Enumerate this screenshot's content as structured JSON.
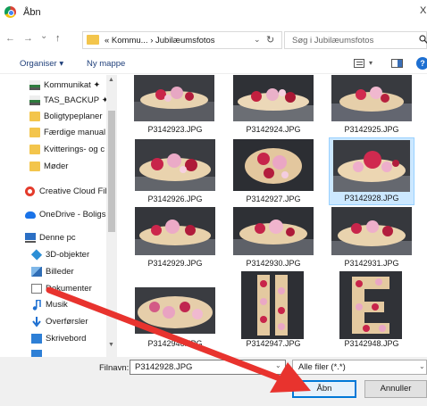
{
  "window": {
    "title": "Åbn",
    "close_glyph": "X"
  },
  "nav": {
    "back_glyph": "←",
    "forward_glyph": "→",
    "history_glyph": "⌄",
    "up_glyph": "↑",
    "breadcrumb": "« Kommu... › Jubilæumsfotos",
    "address_chevron": "⌄",
    "refresh_glyph": "↻",
    "search_placeholder": "Søg i Jubilæumsfotos",
    "search_icon": "search-icon"
  },
  "toolbar": {
    "organiser": "Organiser ▾",
    "new_folder": "Ny mappe",
    "view_chevron": "▾",
    "help": "?"
  },
  "sidebar": {
    "items": [
      {
        "label": "Kommunikat ✦",
        "icon": "drive-icon"
      },
      {
        "label": "TAS_BACKUP ✦",
        "icon": "drive-icon"
      },
      {
        "label": "Boligtypeplaner",
        "icon": "folder-icon"
      },
      {
        "label": "Færdige manual",
        "icon": "folder-icon"
      },
      {
        "label": "Kvitterings- og c",
        "icon": "folder-icon"
      },
      {
        "label": "Møder",
        "icon": "folder-icon"
      },
      {
        "label": "Creative Cloud Fil",
        "icon": "creative-cloud-icon"
      },
      {
        "label": "OneDrive - Boligs",
        "icon": "onedrive-icon"
      },
      {
        "label": "Denne pc",
        "icon": "computer-icon"
      },
      {
        "label": "3D-objekter",
        "icon": "cube-icon"
      },
      {
        "label": "Billeder",
        "icon": "pictures-icon"
      },
      {
        "label": "Dokumenter",
        "icon": "documents-icon"
      },
      {
        "label": "Musik",
        "icon": "music-icon"
      },
      {
        "label": "Overførsler",
        "icon": "download-icon"
      },
      {
        "label": "Skrivebord",
        "icon": "desktop-icon"
      }
    ],
    "scroll_up": "▲",
    "scroll_down": "▼"
  },
  "files": [
    {
      "name": "P3142923.JPG",
      "selected": false
    },
    {
      "name": "P3142924.JPG",
      "selected": false
    },
    {
      "name": "P3142925.JPG",
      "selected": false
    },
    {
      "name": "P3142926.JPG",
      "selected": false
    },
    {
      "name": "P3142927.JPG",
      "selected": false
    },
    {
      "name": "P3142928.JPG",
      "selected": true
    },
    {
      "name": "P3142929.JPG",
      "selected": false
    },
    {
      "name": "P3142930.JPG",
      "selected": false
    },
    {
      "name": "P3142931.JPG",
      "selected": false
    },
    {
      "name": "P3142946.JPG",
      "selected": false
    },
    {
      "name": "P3142947.JPG",
      "selected": false
    },
    {
      "name": "P3142948.JPG",
      "selected": false
    }
  ],
  "footer": {
    "filename_label": "Filnavn:",
    "filename_value": "P3142928.JPG",
    "filename_chevron": "⌄",
    "filter_value": "Alle filer (*.*)",
    "filter_chevron": "⌄",
    "open_label": "Åbn",
    "cancel_label": "Annuller"
  },
  "colors": {
    "accent": "#0078d7",
    "selection": "#cce8ff",
    "arrow": "#e8332e"
  }
}
